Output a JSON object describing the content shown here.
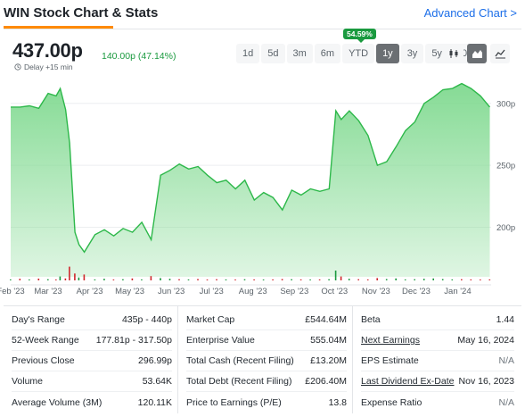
{
  "header": {
    "title": "WIN Stock Chart & Stats",
    "advanced_link": "Advanced Chart >"
  },
  "quote": {
    "price": "437.00p",
    "change": "140.00p (47.14%)",
    "delay": "Delay +15 min"
  },
  "range_selector": {
    "badge": "54.59%",
    "options": [
      "1d",
      "5d",
      "3m",
      "6m",
      "YTD",
      "1y",
      "3y",
      "5y",
      "10y"
    ],
    "active": "1y"
  },
  "chart_type_buttons": [
    {
      "icon": "candlestick-icon",
      "active": false
    },
    {
      "icon": "area-chart-icon",
      "active": true
    },
    {
      "icon": "line-chart-icon",
      "active": false
    }
  ],
  "colors": {
    "accent": "#ff8a00",
    "positive": "#1a9a3f",
    "link": "#1c6ee8",
    "area_line": "#2db84a",
    "area_fill": "#7fd98f",
    "volume_red": "#d0262b",
    "volume_green": "#1a9a3f"
  },
  "chart_data": {
    "type": "area",
    "x": [
      "2023-02-01",
      "2023-02-08",
      "2023-02-15",
      "2023-02-22",
      "2023-03-01",
      "2023-03-07",
      "2023-03-10",
      "2023-03-14",
      "2023-03-17",
      "2023-03-21",
      "2023-03-24",
      "2023-03-28",
      "2023-04-05",
      "2023-04-12",
      "2023-04-19",
      "2023-04-26",
      "2023-05-03",
      "2023-05-10",
      "2023-05-17",
      "2023-05-24",
      "2023-05-31",
      "2023-06-07",
      "2023-06-14",
      "2023-06-21",
      "2023-06-28",
      "2023-07-05",
      "2023-07-12",
      "2023-07-19",
      "2023-07-26",
      "2023-08-02",
      "2023-08-09",
      "2023-08-16",
      "2023-08-23",
      "2023-08-30",
      "2023-09-06",
      "2023-09-13",
      "2023-09-20",
      "2023-09-27",
      "2023-10-02",
      "2023-10-06",
      "2023-10-12",
      "2023-10-19",
      "2023-10-26",
      "2023-11-02",
      "2023-11-09",
      "2023-11-16",
      "2023-11-23",
      "2023-11-30",
      "2023-12-07",
      "2023-12-14",
      "2023-12-21",
      "2023-12-28",
      "2024-01-04",
      "2024-01-11",
      "2024-01-18",
      "2024-01-25"
    ],
    "values": [
      297,
      297,
      298,
      296,
      308,
      306,
      312,
      295,
      268,
      196,
      186,
      180,
      194,
      198,
      193,
      199,
      196,
      204,
      190,
      242,
      246,
      251,
      247,
      249,
      242,
      236,
      238,
      231,
      238,
      222,
      228,
      224,
      214,
      230,
      226,
      231,
      229,
      231,
      294,
      287,
      294,
      286,
      274,
      250,
      253,
      265,
      278,
      285,
      300,
      305,
      311,
      312,
      316,
      312,
      306,
      297
    ],
    "ylabel": "",
    "y_ticks": [
      "300p",
      "250p",
      "200p"
    ],
    "y_tick_values": [
      300,
      250,
      200
    ],
    "ylim": [
      160,
      320
    ],
    "x_tick_labels": [
      "Feb '23",
      "Mar '23",
      "Apr '23",
      "May '23",
      "Jun '23",
      "Jul '23",
      "Aug '23",
      "Sep '23",
      "Oct '23",
      "Nov '23",
      "Dec '23",
      "Jan '24"
    ],
    "x_tick_dates": [
      "2023-02-01",
      "2023-03-01",
      "2023-04-01",
      "2023-05-01",
      "2023-06-01",
      "2023-07-01",
      "2023-08-01",
      "2023-09-01",
      "2023-10-01",
      "2023-11-01",
      "2023-12-01",
      "2024-01-01"
    ],
    "volume": {
      "values": [
        0.05,
        0.08,
        0.03,
        0.09,
        0.06,
        0.04,
        0.2,
        0.1,
        0.7,
        0.35,
        0.15,
        0.3,
        0.05,
        0.08,
        0.04,
        0.06,
        0.1,
        0.05,
        0.22,
        0.12,
        0.08,
        0.06,
        0.05,
        0.07,
        0.04,
        0.06,
        0.05,
        0.04,
        0.06,
        0.05,
        0.04,
        0.05,
        0.07,
        0.06,
        0.05,
        0.04,
        0.05,
        0.06,
        0.5,
        0.2,
        0.08,
        0.06,
        0.05,
        0.12,
        0.07,
        0.1,
        0.05,
        0.06,
        0.08,
        0.1,
        0.07,
        0.05,
        0.06,
        0.05,
        0.04,
        0.05
      ],
      "directions": [
        "up",
        "down",
        "up",
        "down",
        "up",
        "down",
        "up",
        "down",
        "down",
        "down",
        "up",
        "down",
        "up",
        "up",
        "down",
        "up",
        "down",
        "up",
        "down",
        "up",
        "up",
        "down",
        "up",
        "down",
        "down",
        "down",
        "up",
        "down",
        "up",
        "down",
        "up",
        "down",
        "down",
        "up",
        "down",
        "up",
        "down",
        "up",
        "up",
        "down",
        "up",
        "down",
        "down",
        "down",
        "up",
        "up",
        "up",
        "up",
        "up",
        "up",
        "up",
        "up",
        "down",
        "down",
        "down",
        "down"
      ]
    }
  },
  "stats": {
    "col1": [
      {
        "label": "Day's Range",
        "value": "435p - 440p"
      },
      {
        "label": "52-Week Range",
        "value": "177.81p - 317.50p"
      },
      {
        "label": "Previous Close",
        "value": "296.99p"
      },
      {
        "label": "Volume",
        "value": "53.64K"
      },
      {
        "label": "Average Volume (3M)",
        "value": "120.11K"
      }
    ],
    "col2": [
      {
        "label": "Market Cap",
        "value": "£544.64M"
      },
      {
        "label": "Enterprise Value",
        "value": "555.04M"
      },
      {
        "label": "Total Cash (Recent Filing)",
        "value": "£13.20M"
      },
      {
        "label": "Total Debt (Recent Filing)",
        "value": "£206.40M"
      },
      {
        "label": "Price to Earnings (P/E)",
        "value": "13.8"
      }
    ],
    "col3": [
      {
        "label": "Beta",
        "value": "1.44",
        "link": false,
        "muted": false
      },
      {
        "label": "Next Earnings",
        "value": "May 16, 2024",
        "link": true,
        "muted": false
      },
      {
        "label": "EPS Estimate",
        "value": "N/A",
        "link": false,
        "muted": true
      },
      {
        "label": "Last Dividend Ex-Date",
        "value": "Nov 16, 2023",
        "link": true,
        "muted": false
      },
      {
        "label": "Expense Ratio",
        "value": "N/A",
        "link": false,
        "muted": true
      }
    ]
  }
}
